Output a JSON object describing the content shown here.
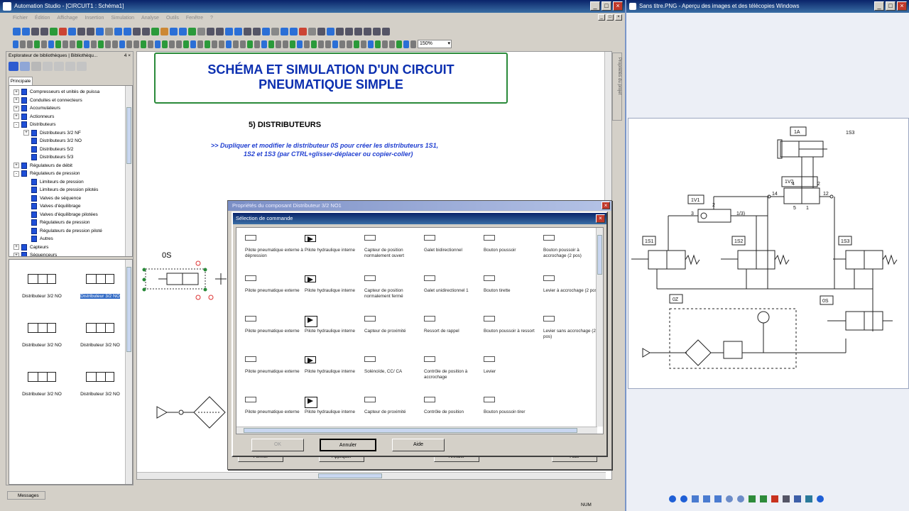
{
  "app": {
    "title": "Automation Studio - [CIRCUIT1 : Schéma1]",
    "menu": [
      "Fichier",
      "Édition",
      "Affichage",
      "Insertion",
      "Simulation",
      "Analyse",
      "Outils",
      "Fenêtre",
      "?"
    ],
    "status_num": "NUM",
    "messages_tab": "Messages",
    "zoom": "150%"
  },
  "library": {
    "title": "Explorateur de bibliothèques | Bibliothèqu...",
    "pin": "4 ×",
    "tab": "Principale",
    "tree": [
      {
        "label": "Compresseurs et unités de puissa",
        "level": 0,
        "exp": "+"
      },
      {
        "label": "Conduites et connecteurs",
        "level": 0,
        "exp": "+"
      },
      {
        "label": "Accumulateurs",
        "level": 0,
        "exp": "+"
      },
      {
        "label": "Actionneurs",
        "level": 0,
        "exp": "+"
      },
      {
        "label": "Distributeurs",
        "level": 0,
        "exp": "-"
      },
      {
        "label": "Distributeurs 3/2 NF",
        "level": 1,
        "exp": "+"
      },
      {
        "label": "Distributeurs 3/2 NO",
        "level": 1,
        "exp": ""
      },
      {
        "label": "Distributeurs 5/2",
        "level": 1,
        "exp": ""
      },
      {
        "label": "Distributeurs 5/3",
        "level": 1,
        "exp": ""
      },
      {
        "label": "Régulateurs de débit",
        "level": 0,
        "exp": "+"
      },
      {
        "label": "Régulateurs de pression",
        "level": 0,
        "exp": "-"
      },
      {
        "label": "Limiteurs de pression",
        "level": 1,
        "exp": ""
      },
      {
        "label": "Limiteurs de pression pilotés",
        "level": 1,
        "exp": ""
      },
      {
        "label": "Valves de séquence",
        "level": 1,
        "exp": ""
      },
      {
        "label": "Valves d'équilibrage",
        "level": 1,
        "exp": ""
      },
      {
        "label": "Valves d'équilibrage pilotées",
        "level": 1,
        "exp": ""
      },
      {
        "label": "Régulateurs de pression",
        "level": 1,
        "exp": ""
      },
      {
        "label": "Régulateurs de pression piloté",
        "level": 1,
        "exp": ""
      },
      {
        "label": "Autres",
        "level": 1,
        "exp": ""
      },
      {
        "label": "Capteurs",
        "level": 0,
        "exp": "+"
      },
      {
        "label": "Séquenceurs",
        "level": 0,
        "exp": "+"
      }
    ],
    "symbols": [
      "Distributeur 3/2 NO",
      "Distributeur 3/2 NO",
      "Distributeur 3/2 NO",
      "Distributeur 3/2 NO",
      "Distributeur 3/2 NO",
      "Distributeur 3/2 NO"
    ]
  },
  "diagram": {
    "title_line1": "SCHÉMA ET SIMULATION D'UN CIRCUIT",
    "title_line2": "PNEUMATIQUE SIMPLE",
    "section": "5) DISTRIBUTEURS",
    "instruction_line1": ">> Dupliquer et modifier le distributeur 0S pour créer les distributeurs 1S1,",
    "instruction_line2": "1S2 et 1S3 (par CTRL+glisser-déplacer ou copier-coller)",
    "label_0s": "0S",
    "side_tab": "Propriétés du projet"
  },
  "props_dialog": {
    "title": "Propriétés du composant Distributeur 3/2 NO1",
    "buttons": [
      "Fermer",
      "Appliquer",
      "Annuler",
      "Aide"
    ]
  },
  "cmd_dialog": {
    "title": "Sélection de commande",
    "cells": [
      "Pilote pneumatique externe à dépression",
      "Pilote hydraulique interne",
      "Capteur de position normalement ouvert",
      "Galet bidirectionnel",
      "Bouton poussoir",
      "Bouton poussoir à accrochage (2 pos)",
      "Pilote pneumatique externe",
      "Pilote hydraulique interne",
      "Capteur de position normalement fermé",
      "Galet unidirectionnel 1",
      "Bouton tirette",
      "Levier à accrochage (2 pos)",
      "Pilote pneumatique externe",
      "Pilote hydraulique interne",
      "Capteur de proximité",
      "Ressort de rappel",
      "Bouton poussoir à ressort",
      "Levier sans accrochage (2 pos)",
      "Pilote pneumatique externe",
      "Pilote hydraulique interne",
      "Solénoïde, CC/ CA",
      "Contrôle de position à accrochage",
      "Levier",
      "",
      "Pilote pneumatique externe",
      "Pilote hydraulique interne",
      "Capteur de proximité",
      "Contrôle de position",
      "Bouton poussoir-tirer",
      ""
    ],
    "buttons": {
      "ok": "OK",
      "cancel": "Annuler",
      "help": "Aide"
    }
  },
  "viewer": {
    "title": "Sans titre.PNG - Aperçu des images et des télécopies Windows",
    "labels": {
      "1A": "1A",
      "1S3_top": "1S3",
      "1V2": "1V2",
      "1V1": "1V1",
      "p14": "14",
      "p12": "12",
      "p2a": "2",
      "p4": "4",
      "p3": "3",
      "p1": "1",
      "p5": "5",
      "p123": "1/3)",
      "p2b": "2",
      "1S1": "1S1",
      "1S2": "1S2",
      "1S3": "1S3",
      "0Z": "0Z",
      "0S": "0S"
    }
  },
  "colors": {
    "accent_blue": "#0b2fb0",
    "frame_green": "#2a8a3a",
    "title_dark": "#0a246a"
  }
}
